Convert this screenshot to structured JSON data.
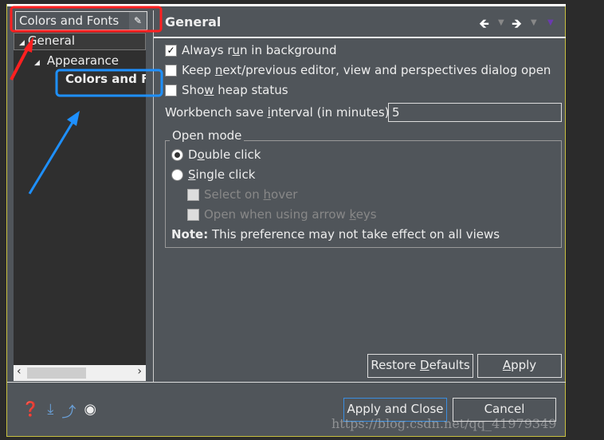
{
  "filter": {
    "value": "Colors and Fonts",
    "clear_icon": "eraser-icon"
  },
  "tree": [
    {
      "label": "General"
    },
    {
      "label": "Appearance"
    },
    {
      "label": "Colors and Fo"
    }
  ],
  "page": {
    "title": "General",
    "always_run": {
      "pre": "Always r",
      "u": "u",
      "post": "n in background",
      "checked": true
    },
    "keep_open": {
      "pre": "Keep ",
      "u": "n",
      "post": "ext/previous editor, view and perspectives dialog open",
      "checked": false
    },
    "heap": {
      "pre": "Sho",
      "u": "w",
      "post": " heap status",
      "checked": false
    },
    "interval": {
      "pre": "Workbench save ",
      "u": "i",
      "post": "nterval (in minutes):",
      "value": "5"
    },
    "open_mode": {
      "label": "Open mode",
      "double": {
        "pre": "D",
        "u": "o",
        "post": "uble click",
        "selected": true
      },
      "single": {
        "pre": "",
        "u": "S",
        "post": "ingle click",
        "selected": false
      },
      "hover": {
        "pre": "Select on ",
        "u": "h",
        "post": "over"
      },
      "arrow": {
        "pre": "Open when using arrow ",
        "u": "k",
        "post": "eys"
      },
      "note_bold": "Note:",
      "note": " This preference may not take effect on all views"
    },
    "restore": {
      "pre": "Restore ",
      "u": "D",
      "post": "efaults"
    },
    "apply": {
      "pre": "",
      "u": "A",
      "post": "pply"
    }
  },
  "footer": {
    "apply_close": "Apply and Close",
    "cancel": "Cancel"
  },
  "watermark": "https://blog.csdn.net/qq_41979349",
  "colors": {
    "annotation_red": "#ff2020",
    "annotation_blue": "#1e90ff",
    "dialog_bg": "#50555a"
  }
}
